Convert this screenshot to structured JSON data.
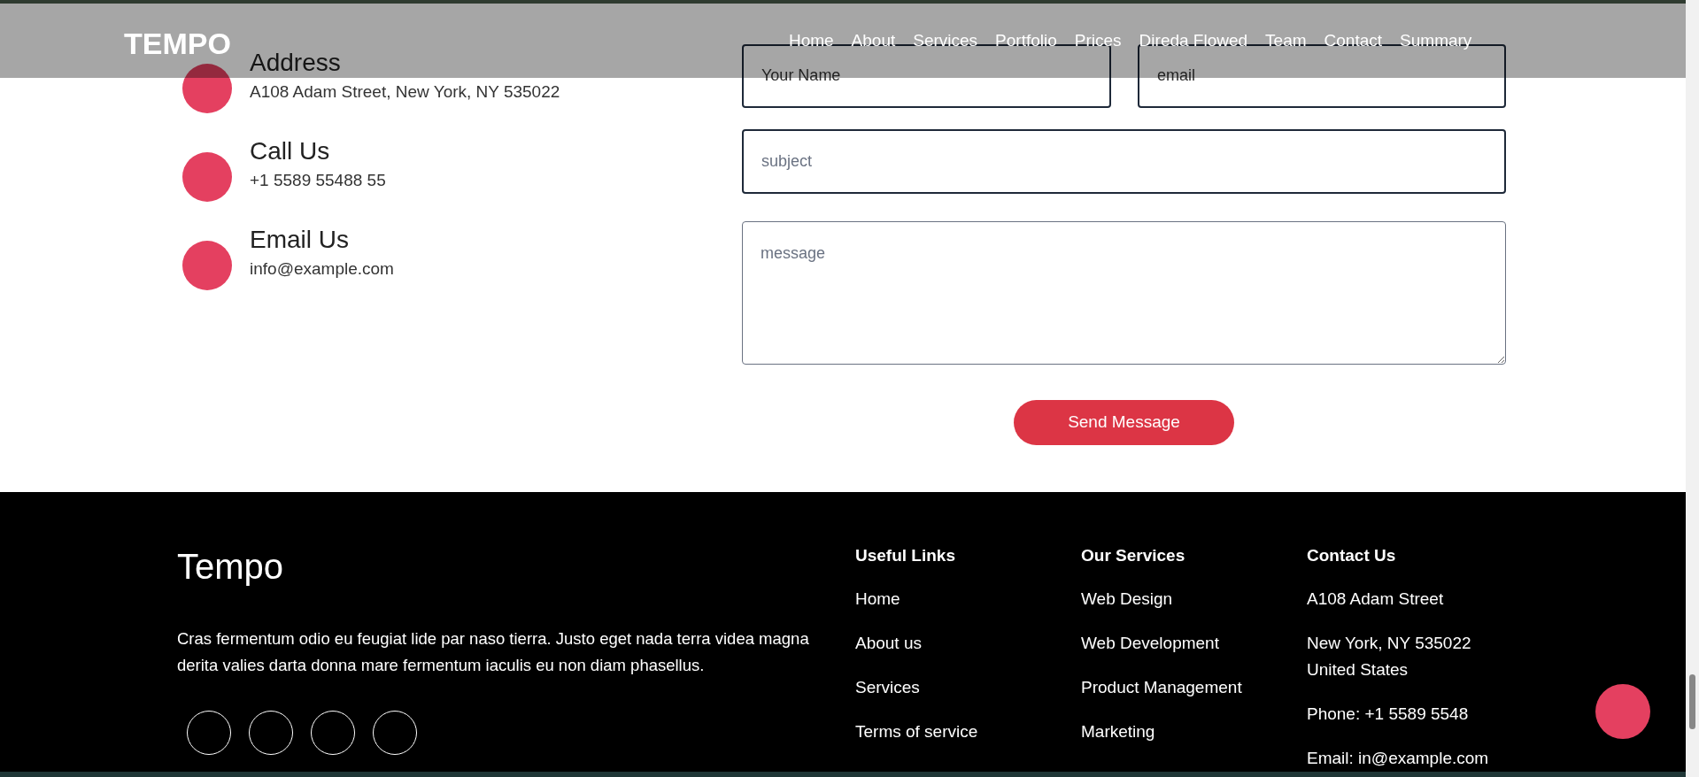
{
  "header": {
    "logo": "TEMPO",
    "nav": [
      {
        "label": "Home"
      },
      {
        "label": "About"
      },
      {
        "label": "Services"
      },
      {
        "label": "Portfolio"
      },
      {
        "label": "Prices"
      },
      {
        "label": "Direda Flowed"
      },
      {
        "label": "Team"
      },
      {
        "label": "Contact"
      },
      {
        "label": "Summary"
      }
    ]
  },
  "contact_info": [
    {
      "title": "Address",
      "text": "A108 Adam Street, New York, NY 535022"
    },
    {
      "title": "Call Us",
      "text": "+1 5589 55488 55"
    },
    {
      "title": "Email Us",
      "text": "info@example.com"
    }
  ],
  "form": {
    "name": {
      "placeholder": "Your Name"
    },
    "email": {
      "placeholder": "email"
    },
    "subject": {
      "placeholder": "subject"
    },
    "message": {
      "placeholder": "message"
    },
    "submit": "Send Message"
  },
  "footer": {
    "brand": "Tempo",
    "about": "Cras fermentum odio eu feugiat lide par naso tierra. Justo eget nada terra videa magna derita valies darta donna mare fermentum iaculis eu non diam phasellus.",
    "columns": [
      {
        "title": "Useful Links",
        "items": [
          "Home",
          "About us",
          "Services",
          "Terms of service"
        ]
      },
      {
        "title": "Our Services",
        "items": [
          "Web Design",
          "Web Development",
          "Product Management",
          "Marketing"
        ]
      },
      {
        "title": "Contact Us",
        "items": [
          "A108 Adam Street",
          "New York, NY 535022\nUnited States",
          "Phone: +1 5589 5548",
          "Email: in@example.com"
        ]
      }
    ]
  }
}
